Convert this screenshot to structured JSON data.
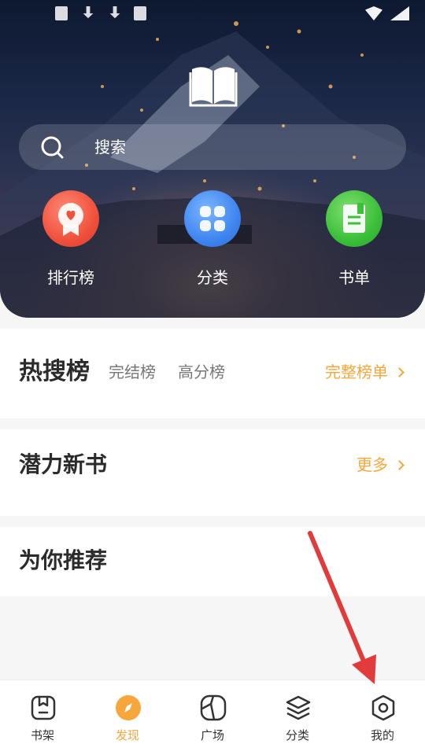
{
  "hero": {
    "search": {
      "placeholder": "搜索",
      "icon": "search-icon"
    },
    "entries": [
      {
        "label": "排行榜",
        "icon": "ranking-medal-icon",
        "color": "#f0513c"
      },
      {
        "label": "分类",
        "icon": "category-grid-icon",
        "color": "#3f86f0"
      },
      {
        "label": "书单",
        "icon": "booklist-icon",
        "color": "#3cbf3a"
      }
    ]
  },
  "sections": {
    "hot": {
      "title": "热搜榜",
      "tabs": [
        "完结榜",
        "高分榜"
      ],
      "more": "完整榜单"
    },
    "potential": {
      "title": "潜力新书",
      "more": "更多"
    },
    "recommend": {
      "title": "为你推荐"
    }
  },
  "nav": {
    "items": [
      {
        "label": "书架",
        "icon": "bookshelf-icon"
      },
      {
        "label": "发现",
        "icon": "compass-icon",
        "active": true
      },
      {
        "label": "广场",
        "icon": "plaza-icon"
      },
      {
        "label": "分类",
        "icon": "layers-icon"
      },
      {
        "label": "我的",
        "icon": "gear-icon"
      }
    ],
    "active_color": "#f6a63b"
  },
  "colors": {
    "accent": "#f6a63b",
    "annotation_arrow": "#e23b3b"
  }
}
